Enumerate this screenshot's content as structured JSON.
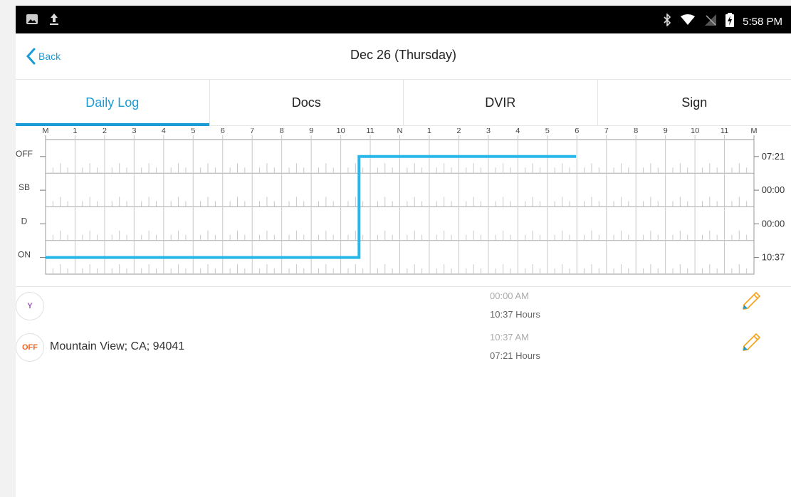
{
  "status_bar": {
    "time": "5:58 PM",
    "icons": [
      "image-icon",
      "upload-icon",
      "bluetooth-icon",
      "wifi-icon",
      "no-signal-icon",
      "battery-charging-icon"
    ]
  },
  "header": {
    "back_label": "Back",
    "title": "Dec 26 (Thursday)"
  },
  "tabs": [
    {
      "label": "Daily Log",
      "active": true
    },
    {
      "label": "Docs",
      "active": false
    },
    {
      "label": "DVIR",
      "active": false
    },
    {
      "label": "Sign",
      "active": false
    }
  ],
  "chart_data": {
    "type": "line",
    "hour_labels": [
      "M",
      "1",
      "2",
      "3",
      "4",
      "5",
      "6",
      "7",
      "8",
      "9",
      "10",
      "11",
      "N",
      "1",
      "2",
      "3",
      "4",
      "5",
      "6",
      "7",
      "8",
      "9",
      "10",
      "11",
      "M"
    ],
    "status_rows": [
      "OFF",
      "SB",
      "D",
      "ON"
    ],
    "row_totals": {
      "OFF": "07:21",
      "SB": "00:00",
      "D": "00:00",
      "ON": "10:37"
    },
    "segments": [
      {
        "status": "ON",
        "start_hour": 0,
        "end_hour": 10.62
      },
      {
        "status": "OFF",
        "start_hour": 10.62,
        "end_hour": 17.97
      }
    ],
    "line_color": "#29b6e8",
    "grid_color": "#c8c8c8"
  },
  "entries": [
    {
      "badge": "Y",
      "badge_color": "#9b59b6",
      "location": "",
      "time": "00:00 AM",
      "duration": "10:37 Hours"
    },
    {
      "badge": "OFF",
      "badge_color": "#f26522",
      "location": "Mountain View; CA; 94041",
      "time": "10:37 AM",
      "duration": "07:21 Hours"
    }
  ],
  "colors": {
    "accent": "#1a9bd7",
    "edit_icon": "#f5a623"
  }
}
